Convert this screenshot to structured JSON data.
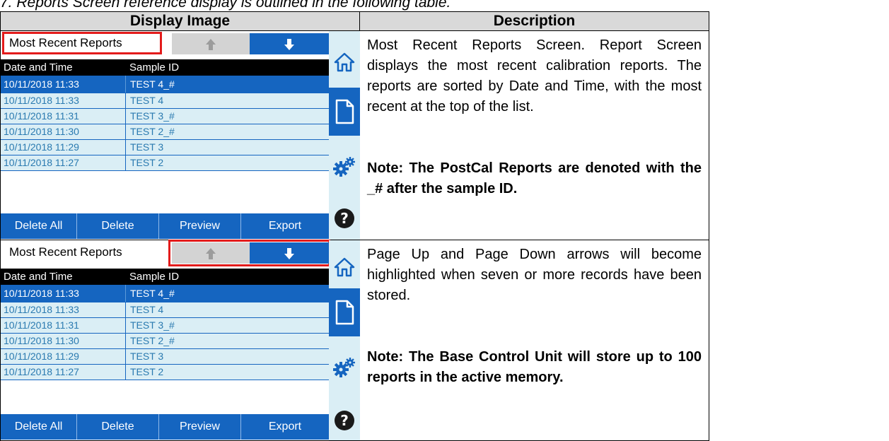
{
  "intro": "7. Reports Screen reference display is outlined in the following table.",
  "table": {
    "headers": {
      "image": "Display Image",
      "description": "Description"
    },
    "rows": [
      {
        "description": "Most Recent Reports Screen. Report Screen displays the most recent calibration reports. The reports are sorted by Date and Time, with the most recent at the top of the list.",
        "note": "Note: The PostCal Reports are denoted with the _# after the sample ID."
      },
      {
        "description": "Page Up and  Page Down arrows will become highlighted when seven or more records have been stored.",
        "note": "Note: The Base Control Unit will store up to 100 reports in the active memory."
      }
    ]
  },
  "screen": {
    "title": "Most Recent Reports",
    "page_up_icon": "arrow-up-icon",
    "page_down_icon": "arrow-down-icon",
    "columns": {
      "date": "Date and Time",
      "sample": "Sample ID"
    },
    "records": [
      {
        "date": "10/11/2018 11:33",
        "sample": "TEST 4_#"
      },
      {
        "date": "10/11/2018 11:33",
        "sample": "TEST 4"
      },
      {
        "date": "10/11/2018 11:31",
        "sample": "TEST 3_#"
      },
      {
        "date": "10/11/2018 11:30",
        "sample": "TEST 2_#"
      },
      {
        "date": "10/11/2018 11:29",
        "sample": "TEST 3"
      },
      {
        "date": "10/11/2018 11:27",
        "sample": "TEST 2"
      }
    ],
    "actions": {
      "delete_all": "Delete All",
      "delete": "Delete",
      "preview": "Preview",
      "export": "Export"
    },
    "side_icons": [
      "home-icon",
      "document-icon",
      "gears-icon",
      "help-icon"
    ]
  },
  "colors": {
    "accent": "#1565c0",
    "row_bg": "#daeef5",
    "highlight": "#e31b1b",
    "header_bg": "#d9d9d9"
  }
}
